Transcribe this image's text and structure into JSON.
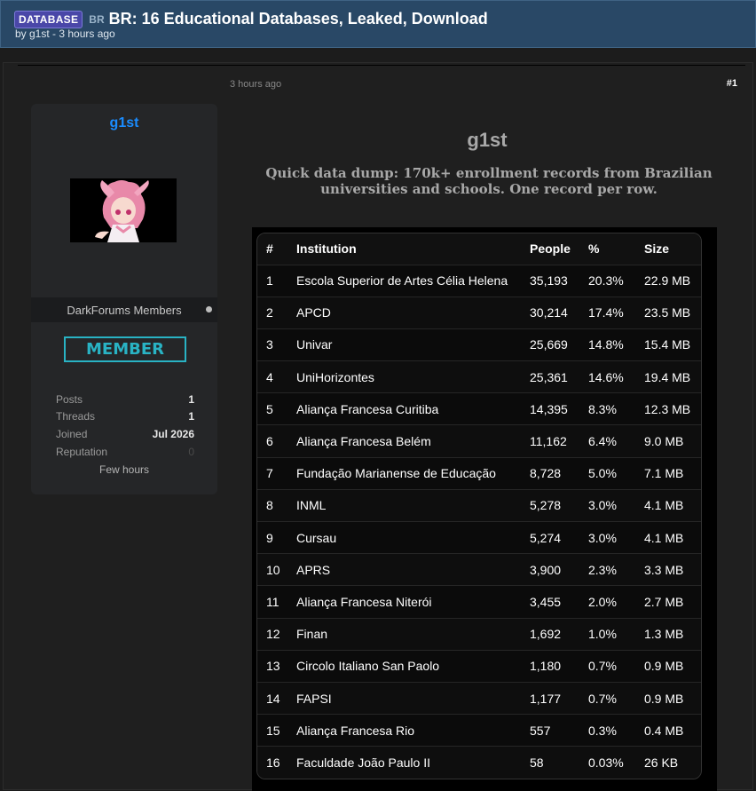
{
  "thread": {
    "prefix": "DATABASE",
    "country_tag": "BR",
    "title": "BR: 16 Educational Databases, Leaked, Download",
    "byline": "by g1st - 3 hours ago"
  },
  "post": {
    "time": "3 hours ago",
    "number": "#1",
    "author_heading": "g1st",
    "description": "Quick data dump: 170k+ enrollment records from Brazilian universities and schools. One record per row."
  },
  "author": {
    "name": "g1st",
    "group": "DarkForums Members",
    "badge": "MEMBER",
    "stats": [
      {
        "label": "Posts",
        "value": "1"
      },
      {
        "label": "Threads",
        "value": "1"
      },
      {
        "label": "Joined",
        "value": "Jul 2026"
      },
      {
        "label": "Reputation",
        "value": "0"
      }
    ],
    "last_seen": "Few hours"
  },
  "table": {
    "headers": [
      "#",
      "Institution",
      "People",
      "%",
      "Size"
    ],
    "rows": [
      [
        "1",
        "Escola Superior de Artes Célia Helena",
        "35,193",
        "20.3%",
        "22.9 MB"
      ],
      [
        "2",
        "APCD",
        "30,214",
        "17.4%",
        "23.5 MB"
      ],
      [
        "3",
        "Univar",
        "25,669",
        "14.8%",
        "15.4 MB"
      ],
      [
        "4",
        "UniHorizontes",
        "25,361",
        "14.6%",
        "19.4 MB"
      ],
      [
        "5",
        "Aliança Francesa Curitiba",
        "14,395",
        "8.3%",
        "12.3 MB"
      ],
      [
        "6",
        "Aliança Francesa Belém",
        "11,162",
        "6.4%",
        "9.0 MB"
      ],
      [
        "7",
        "Fundação Marianense de Educação",
        "8,728",
        "5.0%",
        "7.1 MB"
      ],
      [
        "8",
        "INML",
        "5,278",
        "3.0%",
        "4.1 MB"
      ],
      [
        "9",
        "Cursau",
        "5,274",
        "3.0%",
        "4.1 MB"
      ],
      [
        "10",
        "APRS",
        "3,900",
        "2.3%",
        "3.3 MB"
      ],
      [
        "11",
        "Aliança Francesa Niterói",
        "3,455",
        "2.0%",
        "2.7 MB"
      ],
      [
        "12",
        "Finan",
        "1,692",
        "1.0%",
        "1.3 MB"
      ],
      [
        "13",
        "Circolo Italiano San Paolo",
        "1,180",
        "0.7%",
        "0.9 MB"
      ],
      [
        "14",
        "FAPSI",
        "1,177",
        "0.7%",
        "0.9 MB"
      ],
      [
        "15",
        "Aliança Francesa Rio",
        "557",
        "0.3%",
        "0.4 MB"
      ],
      [
        "16",
        "Faculdade João Paulo II",
        "58",
        "0.03%",
        "26 KB"
      ]
    ]
  },
  "colors": {
    "header_bg": "#294866",
    "prefix_bg": "#4a47a8",
    "username": "#1a8cff",
    "badge": "#29b3c4"
  }
}
